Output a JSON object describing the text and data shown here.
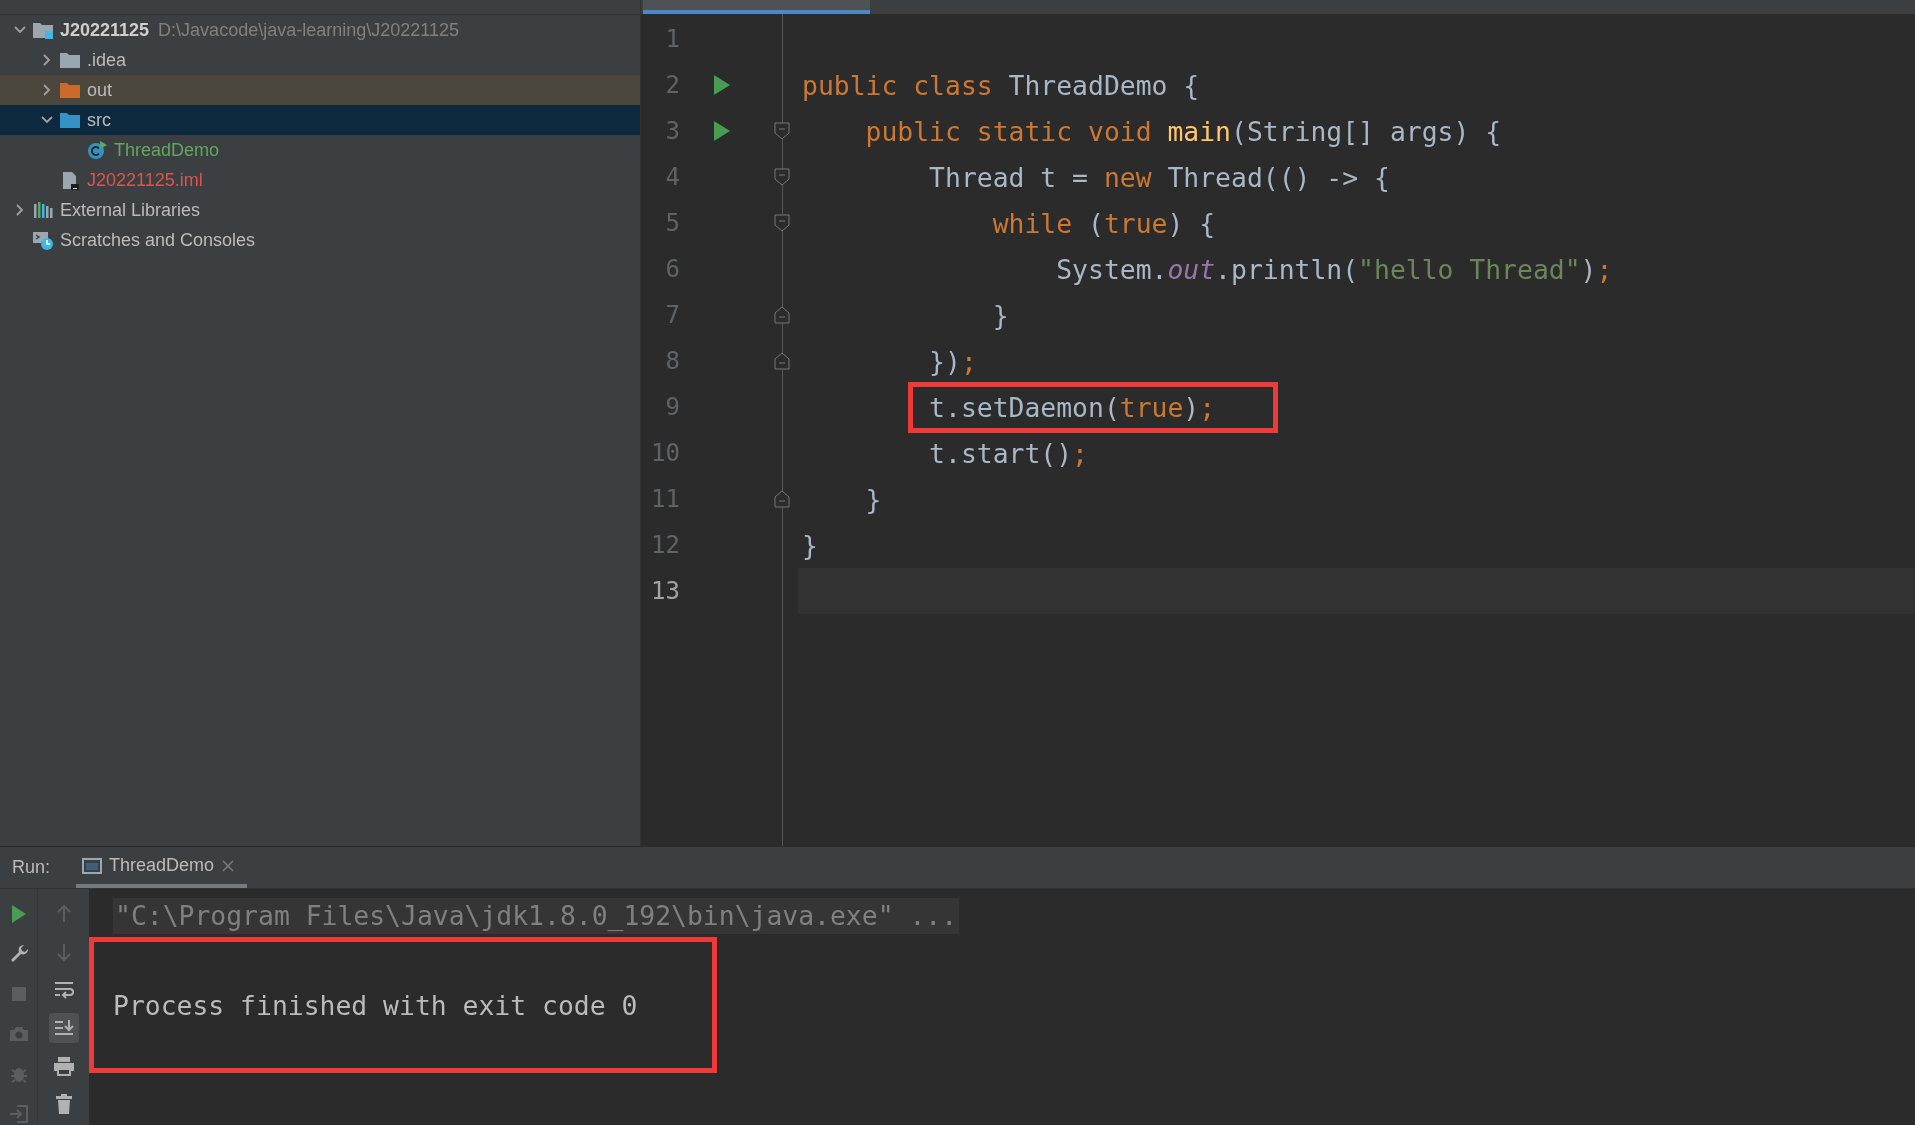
{
  "project_tree": [
    {
      "label": "J20221125",
      "path": "D:\\Javacode\\java-learning\\J20221125",
      "kind": "module",
      "expanded": true,
      "selected": false,
      "highlighted": false,
      "children": [
        {
          "label": ".idea",
          "kind": "folder",
          "expanded": false,
          "selected": false,
          "highlighted": false
        },
        {
          "label": "out",
          "kind": "excluded_folder",
          "expanded": false,
          "selected": false,
          "highlighted": true
        },
        {
          "label": "src",
          "kind": "source_folder",
          "expanded": true,
          "selected": true,
          "highlighted": false,
          "children": [
            {
              "label": "ThreadDemo",
              "kind": "class",
              "color": "#62a85c",
              "selected": false,
              "highlighted": false
            }
          ]
        },
        {
          "label": "J20221125.iml",
          "kind": "file",
          "color": "#d9554d",
          "selected": false,
          "highlighted": false
        }
      ]
    },
    {
      "label": "External Libraries",
      "kind": "libraries",
      "expanded": false,
      "selected": false,
      "highlighted": false
    },
    {
      "label": "Scratches and Consoles",
      "kind": "scratches",
      "selected": false,
      "highlighted": false
    }
  ],
  "editor": {
    "lines": [
      {
        "number": "1",
        "current": false,
        "run_marker": false
      },
      {
        "number": "2",
        "current": false,
        "run_marker": true,
        "tokens": [
          {
            "kind": "keyword",
            "text": "public class "
          },
          {
            "kind": "plain",
            "text": "ThreadDemo {"
          }
        ]
      },
      {
        "number": "3",
        "current": false,
        "run_marker": true,
        "fold_start": true,
        "tokens": [
          {
            "kind": "keyword",
            "text": "    public static void "
          },
          {
            "kind": "method",
            "text": "main"
          },
          {
            "kind": "plain",
            "text": "(String[] args) {"
          }
        ]
      },
      {
        "number": "4",
        "current": false,
        "run_marker": false,
        "fold_start": true,
        "tokens": [
          {
            "kind": "plain",
            "text": "        Thread t = "
          },
          {
            "kind": "keyword",
            "text": "new"
          },
          {
            "kind": "plain",
            "text": " Thread(() -> {"
          }
        ]
      },
      {
        "number": "5",
        "current": false,
        "run_marker": false,
        "fold_start": true,
        "tokens": [
          {
            "kind": "keyword",
            "text": "            while"
          },
          {
            "kind": "plain",
            "text": " ("
          },
          {
            "kind": "keyword",
            "text": "true"
          },
          {
            "kind": "plain",
            "text": ") {"
          }
        ]
      },
      {
        "number": "6",
        "current": false,
        "run_marker": false,
        "tokens": [
          {
            "kind": "plain",
            "text": "                System."
          },
          {
            "kind": "field",
            "text": "out"
          },
          {
            "kind": "plain",
            "text": ".println("
          },
          {
            "kind": "string",
            "text": "\"hello Thread\""
          },
          {
            "kind": "plain",
            "text": ")"
          },
          {
            "kind": "keyword",
            "text": ";"
          }
        ]
      },
      {
        "number": "7",
        "current": false,
        "run_marker": false,
        "fold_end": true,
        "tokens": [
          {
            "kind": "plain",
            "text": "            }"
          }
        ]
      },
      {
        "number": "8",
        "current": false,
        "run_marker": false,
        "fold_end": true,
        "tokens": [
          {
            "kind": "plain",
            "text": "        })"
          },
          {
            "kind": "keyword",
            "text": ";"
          }
        ]
      },
      {
        "number": "9",
        "current": false,
        "run_marker": false,
        "tokens": [
          {
            "kind": "plain",
            "text": "        t.setDaemon(",
            "boxed": true
          },
          {
            "kind": "keyword",
            "text": "true",
            "boxed": true
          },
          {
            "kind": "plain",
            "text": ")",
            "boxed": true
          },
          {
            "kind": "keyword",
            "text": ";",
            "boxed": true
          }
        ]
      },
      {
        "number": "10",
        "current": false,
        "run_marker": false,
        "tokens": [
          {
            "kind": "plain",
            "text": "        t.start()"
          },
          {
            "kind": "keyword",
            "text": ";"
          }
        ]
      },
      {
        "number": "11",
        "current": false,
        "run_marker": false,
        "fold_end": true,
        "tokens": [
          {
            "kind": "plain",
            "text": "    }"
          }
        ]
      },
      {
        "number": "12",
        "current": false,
        "run_marker": false,
        "tokens": [
          {
            "kind": "plain",
            "text": "}"
          }
        ]
      },
      {
        "number": "13",
        "current": true,
        "run_marker": false
      }
    ]
  },
  "run_panel": {
    "label": "Run:",
    "tabs": [
      {
        "label": "ThreadDemo",
        "selected": true
      }
    ],
    "toolbar": [
      [
        {
          "kind": "run",
          "disabled": false
        },
        {
          "kind": "wrench",
          "disabled": false
        },
        {
          "kind": "stop",
          "disabled": true
        },
        {
          "kind": "camera",
          "disabled": true
        },
        {
          "kind": "bug",
          "disabled": true
        },
        {
          "kind": "exit",
          "disabled": true
        }
      ],
      [
        {
          "kind": "up",
          "disabled": true,
          "on": false
        },
        {
          "kind": "down",
          "disabled": true,
          "on": false
        },
        {
          "kind": "wrap",
          "disabled": false,
          "on": false
        },
        {
          "kind": "scroll_end",
          "disabled": false,
          "on": true
        },
        {
          "kind": "print",
          "disabled": false,
          "on": false
        },
        {
          "kind": "trash",
          "disabled": false,
          "on": false
        }
      ]
    ],
    "console": [
      {
        "kind": "command",
        "text": "\"C:\\Program Files\\Java\\jdk1.8.0_192\\bin\\java.exe\" ...",
        "boxed": false
      },
      {
        "kind": "output",
        "text": "Process finished with exit code 0",
        "boxed": true
      }
    ]
  }
}
